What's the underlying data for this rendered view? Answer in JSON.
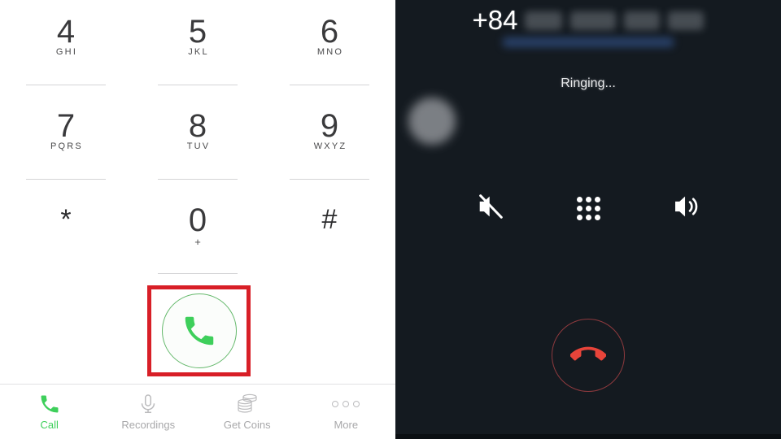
{
  "dialer": {
    "keys": [
      {
        "digit": "4",
        "letters": "GHI"
      },
      {
        "digit": "5",
        "letters": "JKL"
      },
      {
        "digit": "6",
        "letters": "MNO"
      },
      {
        "digit": "7",
        "letters": "PQRS"
      },
      {
        "digit": "8",
        "letters": "TUV"
      },
      {
        "digit": "9",
        "letters": "WXYZ"
      },
      {
        "digit": "*",
        "letters": ""
      },
      {
        "digit": "0",
        "letters": "+"
      },
      {
        "digit": "#",
        "letters": ""
      }
    ],
    "call_button": {
      "icon": "phone-handset-icon",
      "color": "#3ecf5b",
      "highlight_color": "#d81f27"
    },
    "tabs": [
      {
        "label": "Call",
        "icon": "phone-handset-icon",
        "active": true
      },
      {
        "label": "Recordings",
        "icon": "microphone-icon",
        "active": false
      },
      {
        "label": "Get Coins",
        "icon": "coin-stack-icon",
        "active": false
      },
      {
        "label": "More",
        "icon": "three-dots-icon",
        "active": false
      }
    ]
  },
  "call_screen": {
    "country_code": "+84",
    "number_redacted": true,
    "status": "Ringing...",
    "avatar": "blurred-contact-avatar",
    "actions": [
      {
        "label": "mute",
        "icon": "speaker-mute-icon"
      },
      {
        "label": "keypad",
        "icon": "keypad-grid-icon"
      },
      {
        "label": "speaker",
        "icon": "speaker-on-icon"
      }
    ],
    "end_call": {
      "icon": "end-call-handset-icon",
      "color": "#e8443a",
      "ring_color": "#8e3a3e"
    },
    "background_color": "#141a20"
  }
}
